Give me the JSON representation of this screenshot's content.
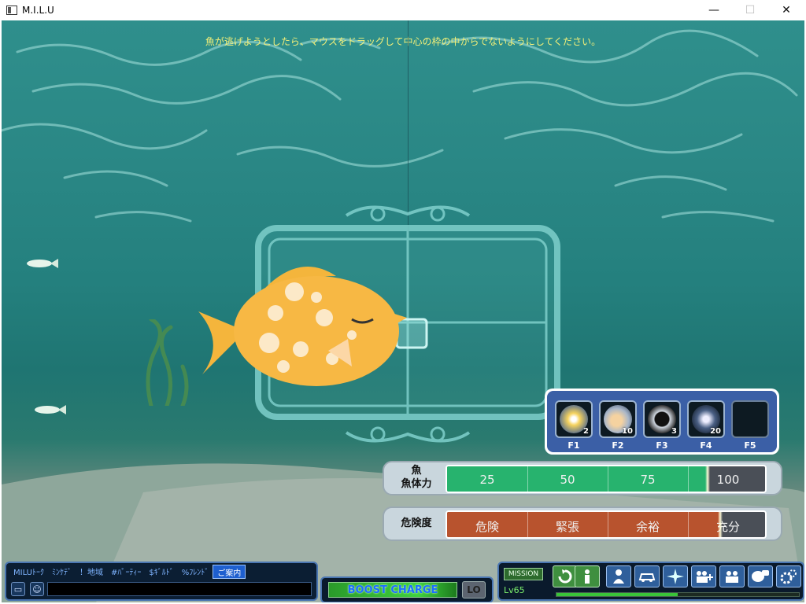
{
  "window": {
    "title": "M.I.L.U",
    "minimize": "—",
    "maximize": "☐",
    "close": "✕"
  },
  "hint_text": "魚が逃げようとしたら、マウスをドラッグして中心の枠の中からでないようにしてください。",
  "skills": [
    {
      "key": "F1",
      "count": "2",
      "icon": "sparkle-orb-icon"
    },
    {
      "key": "F2",
      "count": "10",
      "icon": "bubble-orb-icon"
    },
    {
      "key": "F3",
      "count": "3",
      "icon": "black-orb-icon"
    },
    {
      "key": "F4",
      "count": "20",
      "icon": "star-orb-icon"
    },
    {
      "key": "F5",
      "count": "",
      "icon": "empty-slot"
    }
  ],
  "fish_stamina": {
    "label_line1": "魚",
    "label_line2": "魚体力",
    "ticks": [
      "25",
      "50",
      "75",
      "100"
    ],
    "fill_color": "#27b36e",
    "marker_percent": 82
  },
  "danger": {
    "label": "危険度",
    "ticks": [
      "危険",
      "緊張",
      "余裕",
      "充分"
    ],
    "fill_color": "#b8532e",
    "marker_percent": 86
  },
  "chat": {
    "tabs": [
      "MILUﾄｰｸ",
      "ﾐﾝｹﾃﾞ",
      "！地域",
      "#ﾊﾟｰﾃｨｰ",
      "$ｷﾞﾙﾄﾞ",
      "%ﾌﾚﾝﾄﾞ",
      "ご案内"
    ],
    "active_tab": 6
  },
  "boost": {
    "label": "BOOST CHARGE",
    "lo_label": "LO"
  },
  "menu": {
    "mission_label": "MISSION",
    "level": "Lv65",
    "xp_percent": 50
  }
}
